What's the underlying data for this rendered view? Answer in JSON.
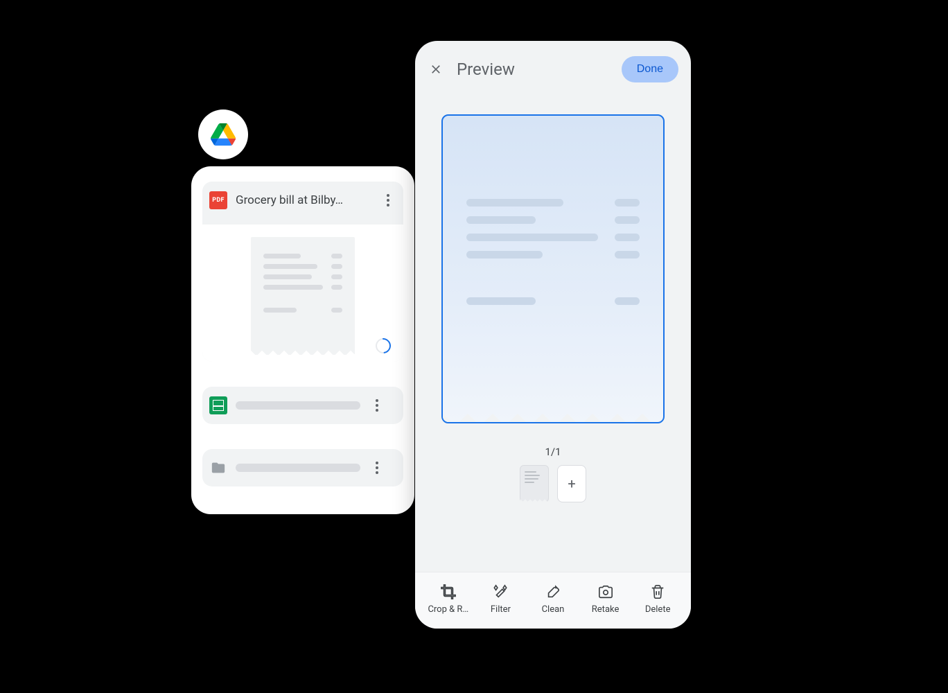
{
  "drive": {
    "files": [
      {
        "name": "Grocery bill at Bilby…",
        "type": "pdf",
        "expanded": true,
        "loading": true
      },
      {
        "name": "",
        "type": "sheets",
        "skeleton": true
      },
      {
        "name": "",
        "type": "folder",
        "skeleton": true
      }
    ]
  },
  "preview": {
    "title": "Preview",
    "done_label": "Done",
    "page_counter": "1/1",
    "actions": [
      {
        "id": "crop",
        "label": "Crop & R…"
      },
      {
        "id": "filter",
        "label": "Filter"
      },
      {
        "id": "clean",
        "label": "Clean"
      },
      {
        "id": "retake",
        "label": "Retake"
      },
      {
        "id": "delete",
        "label": "Delete"
      }
    ],
    "add_label": "+"
  }
}
